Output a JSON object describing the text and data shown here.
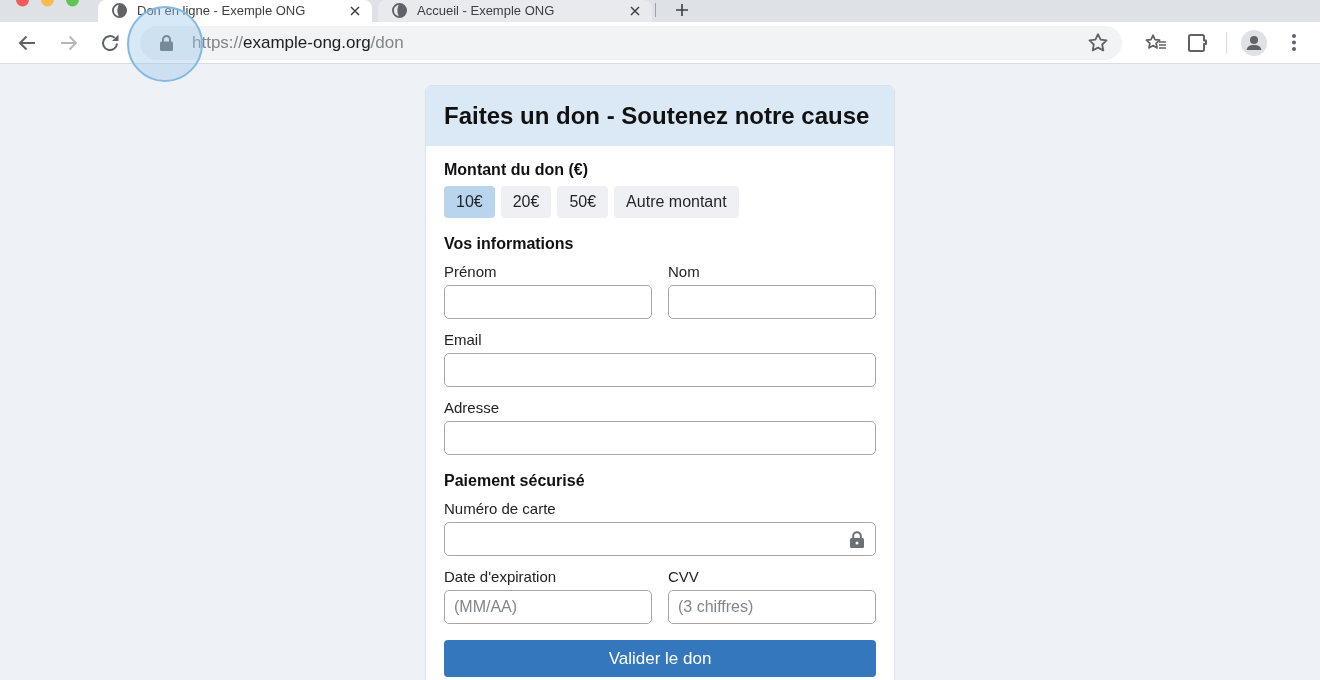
{
  "browser": {
    "tabs": [
      {
        "title": "Don en ligne - Exemple ONG",
        "selected": true
      },
      {
        "title": "Accueil - Exemple ONG",
        "selected": false
      }
    ],
    "forward_disabled": true,
    "lock_highlighted": true,
    "address": {
      "scheme": "https://",
      "host": "example-ong.org",
      "path": "/don"
    }
  },
  "form": {
    "title": "Faites un don - Soutenez notre cause",
    "sections": [
      {
        "kind": "amounts",
        "heading": "Montant du don (€)",
        "options": [
          {
            "label": "10€",
            "selected": true
          },
          {
            "label": "20€",
            "selected": false
          },
          {
            "label": "50€",
            "selected": false
          },
          {
            "label": "Autre montant",
            "selected": false
          }
        ]
      },
      {
        "kind": "fields",
        "heading": "Vos informations",
        "rows": [
          [
            {
              "label": "Prénom",
              "locked": false
            },
            {
              "label": "Nom",
              "locked": false
            }
          ],
          [
            {
              "label": "Email",
              "locked": false
            }
          ],
          [
            {
              "label": "Adresse",
              "locked": false
            }
          ]
        ]
      },
      {
        "kind": "fields",
        "heading": "Paiement sécurisé",
        "rows": [
          [
            {
              "label": "Numéro de carte",
              "locked": true
            }
          ],
          [
            {
              "label": "Date d'expiration",
              "placeholder": "(MM/AA)",
              "locked": false
            },
            {
              "label": "CVV",
              "placeholder": "(3 chiffres)",
              "locked": false
            }
          ]
        ]
      }
    ],
    "submit": "Valider le don"
  }
}
